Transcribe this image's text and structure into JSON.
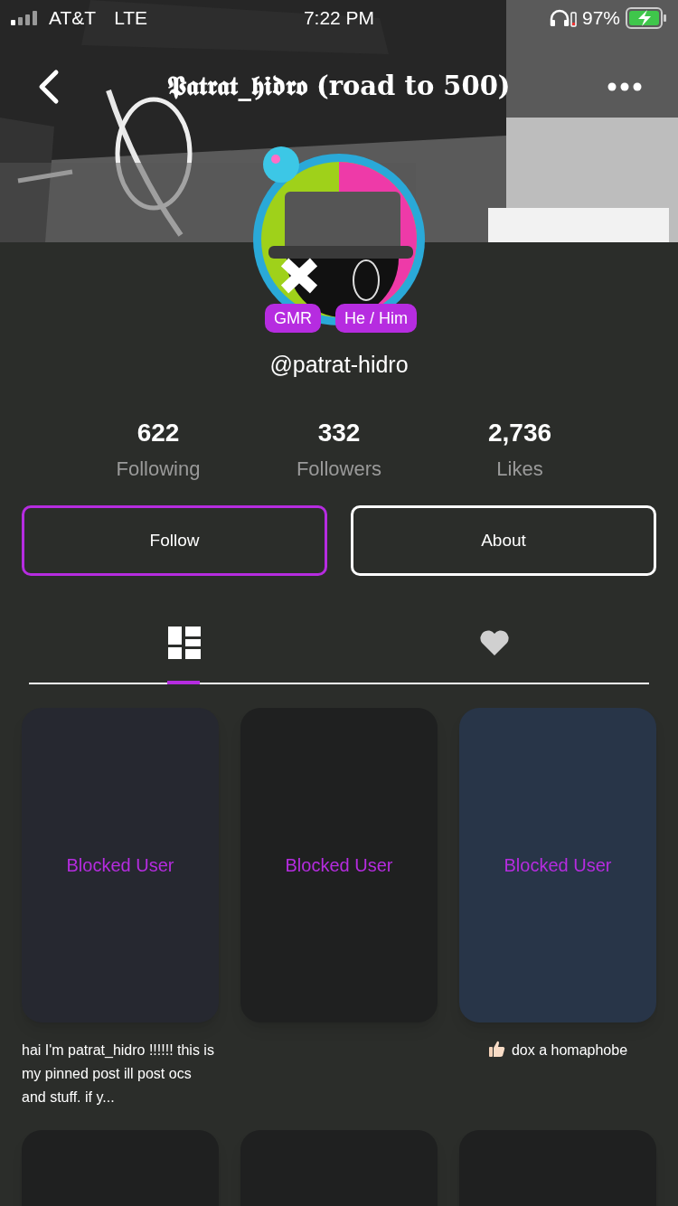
{
  "status_bar": {
    "carrier": "AT&T",
    "network": "LTE",
    "time": "7:22 PM",
    "battery": "97%"
  },
  "header": {
    "title": "𝕻𝖆𝖙𝖗𝖆𝖙_𝖍𝖎𝖉𝖗𝖔 (road to 500)"
  },
  "profile": {
    "badges": [
      "GMR",
      "He / Him"
    ],
    "username": "@patrat-hidro",
    "stats": [
      {
        "value": "622",
        "label": "Following"
      },
      {
        "value": "332",
        "label": "Followers"
      },
      {
        "value": "2,736",
        "label": "Likes"
      }
    ],
    "buttons": [
      {
        "label": "Follow",
        "highlighted": true
      },
      {
        "label": "About",
        "highlighted": false
      }
    ]
  },
  "tabs": [
    {
      "kind": "grid",
      "selected": true
    },
    {
      "kind": "heart",
      "selected": false
    }
  ],
  "posts": [
    {
      "overlay": "Blocked User",
      "color": "#262830",
      "caption": "hai I'm patrat_hidro !!!!!! this is my pinned post ill post ocs and stuff. if y...",
      "thumbs_up": false
    },
    {
      "overlay": "Blocked User",
      "color": "#1f2020"
    },
    {
      "overlay": "Blocked User",
      "color": "#283548",
      "caption": "dox a homaphobe",
      "thumbs_up": true
    },
    {
      "color": "#1f2020"
    },
    {
      "color": "#1f2020"
    },
    {
      "color": "#1f2020"
    }
  ]
}
